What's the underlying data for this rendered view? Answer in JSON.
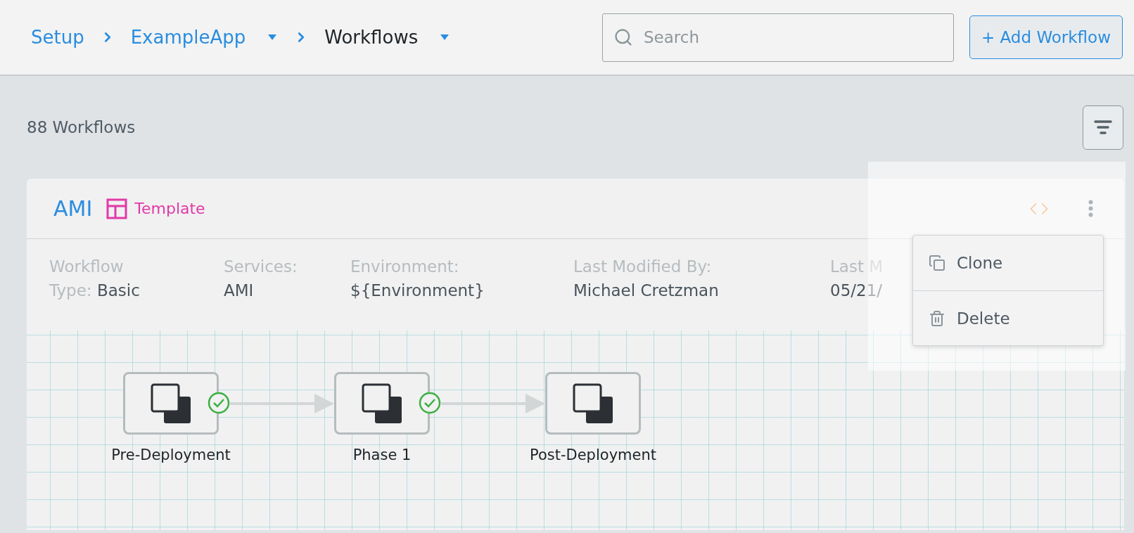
{
  "breadcrumbs": [
    {
      "label": "Setup",
      "current": false,
      "dropdown": false
    },
    {
      "label": "ExampleApp",
      "current": false,
      "dropdown": true
    },
    {
      "label": "Workflows",
      "current": true,
      "dropdown": true
    }
  ],
  "search": {
    "placeholder": "Search"
  },
  "add_button": "+ Add Workflow",
  "count": "88 Workflows",
  "card": {
    "title": "AMI",
    "badge": "Template",
    "details": [
      {
        "label": "Workflow Type:",
        "value": "Basic"
      },
      {
        "label": "Services:",
        "value": "AMI"
      },
      {
        "label": "Environment:",
        "value": "${Environment}"
      },
      {
        "label": "Last Modified By:",
        "value": "Michael Cretzman"
      },
      {
        "label": "Last M",
        "value": "05/21/"
      }
    ],
    "menu": [
      {
        "kind": "clone",
        "label": "Clone"
      },
      {
        "kind": "delete",
        "label": "Delete"
      }
    ],
    "stages": [
      {
        "label": "Pre-Deployment",
        "checked": true
      },
      {
        "label": "Phase 1",
        "checked": true
      },
      {
        "label": "Post-Deployment",
        "checked": false
      }
    ]
  }
}
